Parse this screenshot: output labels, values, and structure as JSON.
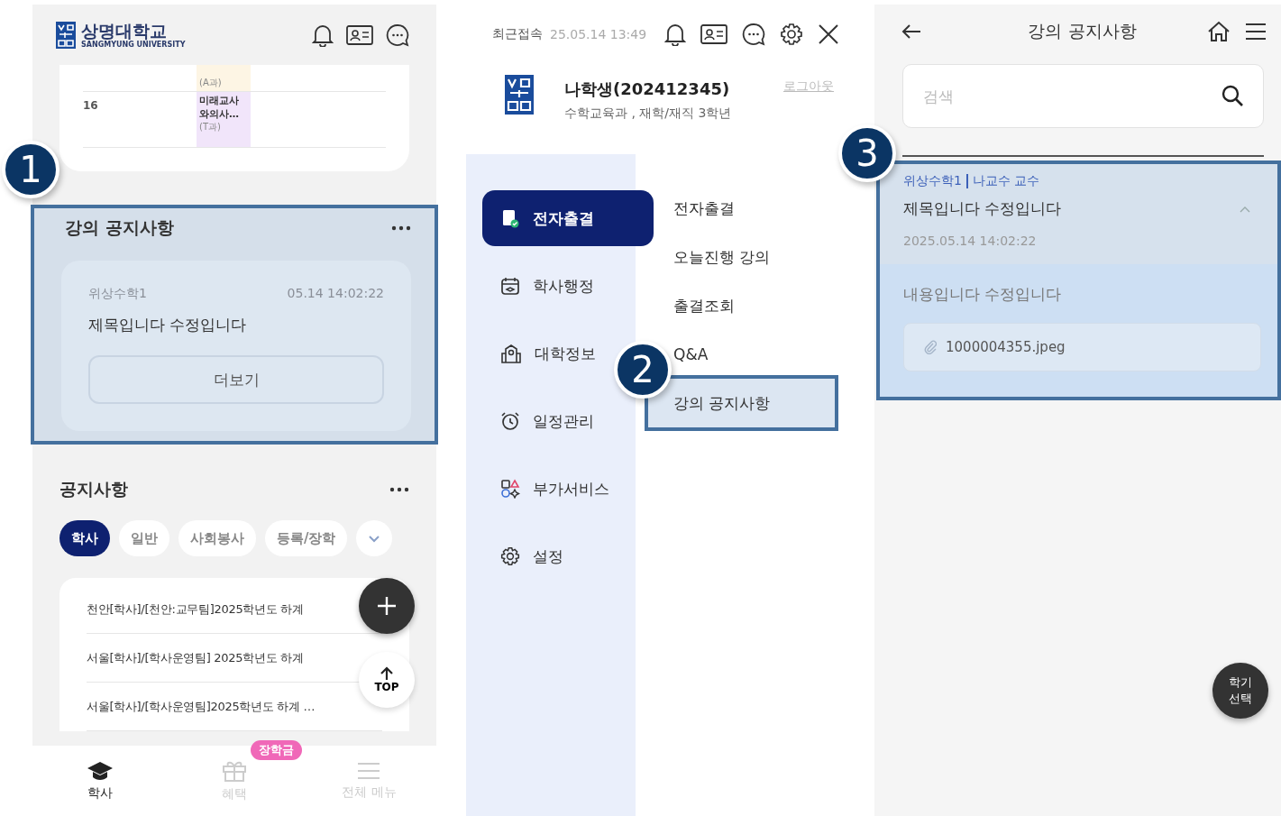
{
  "home_screen": {
    "logo": {
      "name": "상명대학교",
      "subtitle": "SANGMYUNG UNIVERSITY"
    },
    "timetable": {
      "rows": [
        {
          "course": "(A과)",
          "color": "#fdf5e4"
        },
        {
          "period": "16",
          "course": "미래교사 와의사…",
          "room": "(T과)",
          "color": "#f1e5fa"
        }
      ]
    },
    "lecture_notice": {
      "title": "강의 공지사항",
      "callout": "1",
      "course": "위상수학1",
      "time": "05.14 14:02:22",
      "subject": "제목입니다 수정입니다",
      "button": "더보기"
    },
    "notices": {
      "title": "공지사항",
      "chips": [
        {
          "label": "학사",
          "selected": true
        },
        {
          "label": "일반",
          "selected": false
        },
        {
          "label": "사회봉사",
          "selected": false
        },
        {
          "label": "등록/장학",
          "selected": false
        }
      ],
      "rows": [
        "천안[학사]/[천안:교무팀]2025학년도 하계",
        "서울[학사]/[학사운영팀] 2025학년도 하계",
        "서울[학사]/[학사운영팀]2025학년도 하계 …"
      ],
      "top_button": "TOP"
    },
    "bottom_nav": [
      {
        "kind": "cap",
        "label": "학사",
        "selected": true
      },
      {
        "kind": "gift",
        "label": "혜택",
        "selected": false,
        "badge": "장학금"
      },
      {
        "kind": "menu",
        "label": "전체 메뉴",
        "selected": false
      }
    ]
  },
  "menu_screen": {
    "last_login_label": "최근접속",
    "last_login": "25.05.14 13:49",
    "user": {
      "name": "나학생(202412345)",
      "dept": "수학교육과 , 재학/재직 3학년"
    },
    "logout": "로그아웃",
    "categories": [
      {
        "kind": "attendance",
        "label": "전자출결",
        "selected": true
      },
      {
        "kind": "calendar",
        "label": "학사행정",
        "selected": false
      },
      {
        "kind": "building",
        "label": "대학정보",
        "selected": false
      },
      {
        "kind": "alarm",
        "label": "일정관리",
        "selected": false
      },
      {
        "kind": "shapes",
        "label": "부가서비스",
        "selected": false
      },
      {
        "kind": "gear",
        "label": "설정",
        "selected": false
      }
    ],
    "submenu": [
      {
        "label": "전자출결"
      },
      {
        "label": "오늘진행 강의"
      },
      {
        "label": "출결조회"
      },
      {
        "label": "Q&A"
      },
      {
        "label": "강의 공지사항",
        "callout": "2"
      }
    ]
  },
  "notice_screen": {
    "title": "강의 공지사항",
    "search": {
      "placeholder": "검색"
    },
    "notice": {
      "callout": "3",
      "course": "위상수학1",
      "professor": "나교수 교수",
      "title": "제목입니다 수정입니다",
      "date": "2025.05.14 14:02:22",
      "expanded": true,
      "body": "내용입니다 수정입니다",
      "attachment": "1000004355.jpeg"
    },
    "semester_button": "학기 선택"
  }
}
